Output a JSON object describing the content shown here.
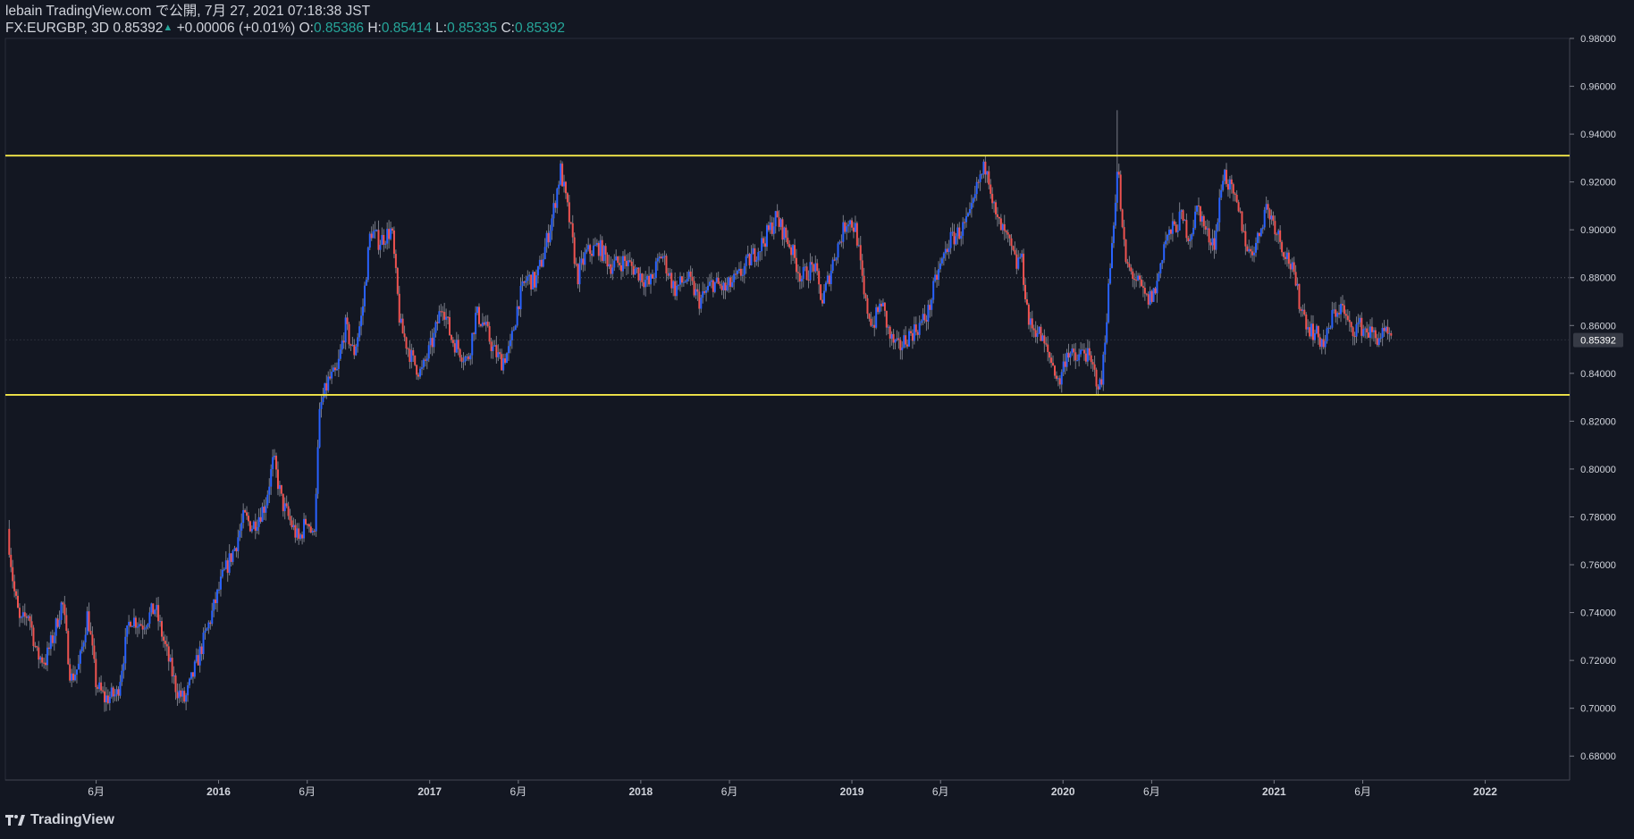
{
  "header": {
    "publisher_line": "lebain TradingView.com で公開, 7月 27, 2021 07:18:38 JST",
    "symbol": "FX:EURGBP, 3D",
    "last": "0.85392",
    "change": "+0.00006 (+0.01%)",
    "o_label": "O:",
    "o_value": "0.85386",
    "h_label": "H:",
    "h_value": "0.85414",
    "l_label": "L:",
    "l_value": "0.85335",
    "c_label": "C:",
    "c_value": "0.85392"
  },
  "footer": {
    "brand": "TradingView"
  },
  "colors": {
    "background": "#131722",
    "up": "#2962ff",
    "down": "#ef5350",
    "wick": "#787b86",
    "level_line": "#f5e94a",
    "axis_text": "#d1d4dc",
    "value_tag": "#363a45"
  },
  "chart_data": {
    "type": "candlestick",
    "symbol": "FX:EURGBP",
    "timeframe": "3D",
    "ylim": [
      0.67,
      0.98
    ],
    "y_ticks": [
      "0.68000",
      "0.70000",
      "0.72000",
      "0.74000",
      "0.76000",
      "0.78000",
      "0.80000",
      "0.82000",
      "0.84000",
      "0.86000",
      "0.88000",
      "0.90000",
      "0.92000",
      "0.94000",
      "0.96000",
      "0.98000"
    ],
    "x_ticks": [
      {
        "label": "6月",
        "t": 2015.42
      },
      {
        "label": "2016",
        "t": 2016.0
      },
      {
        "label": "6月",
        "t": 2016.42
      },
      {
        "label": "2017",
        "t": 2017.0
      },
      {
        "label": "6月",
        "t": 2017.42
      },
      {
        "label": "2018",
        "t": 2018.0
      },
      {
        "label": "6月",
        "t": 2018.42
      },
      {
        "label": "2019",
        "t": 2019.0
      },
      {
        "label": "6月",
        "t": 2019.42
      },
      {
        "label": "2020",
        "t": 2020.0
      },
      {
        "label": "6月",
        "t": 2020.42
      },
      {
        "label": "2021",
        "t": 2021.0
      },
      {
        "label": "6月",
        "t": 2021.42
      },
      {
        "label": "2022",
        "t": 2022.0
      }
    ],
    "xlim": [
      2014.99,
      2022.4
    ],
    "horizontal_levels": [
      0.931,
      0.831
    ],
    "current_price_tag": "0.85392",
    "close_path": [
      [
        "2015.00",
        0.775
      ],
      [
        "2015.03",
        0.75
      ],
      [
        "2015.06",
        0.735
      ],
      [
        "2015.10",
        0.74
      ],
      [
        "2015.14",
        0.722
      ],
      [
        "2015.18",
        0.72
      ],
      [
        "2015.22",
        0.731
      ],
      [
        "2015.26",
        0.745
      ],
      [
        "2015.30",
        0.712
      ],
      [
        "2015.34",
        0.718
      ],
      [
        "2015.38",
        0.74
      ],
      [
        "2015.42",
        0.71
      ],
      [
        "2015.46",
        0.704
      ],
      [
        "2015.52",
        0.706
      ],
      [
        "2015.58",
        0.738
      ],
      [
        "2015.64",
        0.735
      ],
      [
        "2015.70",
        0.742
      ],
      [
        "2015.74",
        0.728
      ],
      [
        "2015.80",
        0.708
      ],
      [
        "2015.84",
        0.703
      ],
      [
        "2015.90",
        0.72
      ],
      [
        "2015.96",
        0.737
      ],
      [
        "2016.02",
        0.755
      ],
      [
        "2016.08",
        0.768
      ],
      [
        "2016.12",
        0.78
      ],
      [
        "2016.16",
        0.776
      ],
      [
        "2016.22",
        0.785
      ],
      [
        "2016.26",
        0.804
      ],
      [
        "2016.30",
        0.786
      ],
      [
        "2016.34",
        0.778
      ],
      [
        "2016.38",
        0.77
      ],
      [
        "2016.42",
        0.78
      ],
      [
        "2016.45",
        0.77
      ],
      [
        "2016.48",
        0.825
      ],
      [
        "2016.52",
        0.837
      ],
      [
        "2016.56",
        0.84
      ],
      [
        "2016.60",
        0.86
      ],
      [
        "2016.64",
        0.848
      ],
      [
        "2016.68",
        0.865
      ],
      [
        "2016.72",
        0.9
      ],
      [
        "2016.76",
        0.895
      ],
      [
        "2016.82",
        0.9
      ],
      [
        "2016.86",
        0.86
      ],
      [
        "2016.92",
        0.845
      ],
      [
        "2016.96",
        0.84
      ],
      [
        "2017.02",
        0.855
      ],
      [
        "2017.06",
        0.87
      ],
      [
        "2017.10",
        0.855
      ],
      [
        "2017.14",
        0.85
      ],
      [
        "2017.18",
        0.845
      ],
      [
        "2017.22",
        0.865
      ],
      [
        "2017.26",
        0.86
      ],
      [
        "2017.30",
        0.85
      ],
      [
        "2017.34",
        0.845
      ],
      [
        "2017.38",
        0.85
      ],
      [
        "2017.42",
        0.87
      ],
      [
        "2017.46",
        0.88
      ],
      [
        "2017.50",
        0.878
      ],
      [
        "2017.54",
        0.89
      ],
      [
        "2017.58",
        0.905
      ],
      [
        "2017.62",
        0.925
      ],
      [
        "2017.66",
        0.905
      ],
      [
        "2017.70",
        0.88
      ],
      [
        "2017.74",
        0.89
      ],
      [
        "2017.80",
        0.893
      ],
      [
        "2017.86",
        0.885
      ],
      [
        "2017.92",
        0.887
      ],
      [
        "2017.98",
        0.883
      ],
      [
        "2018.04",
        0.877
      ],
      [
        "2018.10",
        0.89
      ],
      [
        "2018.16",
        0.875
      ],
      [
        "2018.22",
        0.88
      ],
      [
        "2018.28",
        0.87
      ],
      [
        "2018.34",
        0.878
      ],
      [
        "2018.40",
        0.875
      ],
      [
        "2018.46",
        0.88
      ],
      [
        "2018.52",
        0.888
      ],
      [
        "2018.58",
        0.895
      ],
      [
        "2018.64",
        0.905
      ],
      [
        "2018.70",
        0.895
      ],
      [
        "2018.76",
        0.88
      ],
      [
        "2018.82",
        0.885
      ],
      [
        "2018.86",
        0.87
      ],
      [
        "2018.92",
        0.89
      ],
      [
        "2018.98",
        0.905
      ],
      [
        "2019.02",
        0.9
      ],
      [
        "2019.06",
        0.87
      ],
      [
        "2019.10",
        0.86
      ],
      [
        "2019.14",
        0.87
      ],
      [
        "2019.18",
        0.855
      ],
      [
        "2019.22",
        0.85
      ],
      [
        "2019.26",
        0.855
      ],
      [
        "2019.32",
        0.86
      ],
      [
        "2019.36",
        0.865
      ],
      [
        "2019.40",
        0.88
      ],
      [
        "2019.46",
        0.895
      ],
      [
        "2019.52",
        0.9
      ],
      [
        "2019.56",
        0.905
      ],
      [
        "2019.60",
        0.92
      ],
      [
        "2019.64",
        0.928
      ],
      [
        "2019.68",
        0.905
      ],
      [
        "2019.74",
        0.895
      ],
      [
        "2019.78",
        0.885
      ],
      [
        "2019.80",
        0.89
      ],
      [
        "2019.84",
        0.86
      ],
      [
        "2019.88",
        0.858
      ],
      [
        "2019.92",
        0.85
      ],
      [
        "2019.96",
        0.842
      ],
      [
        "2019.98",
        0.835
      ],
      [
        "2020.02",
        0.85
      ],
      [
        "2020.06",
        0.845
      ],
      [
        "2020.10",
        0.85
      ],
      [
        "2020.14",
        0.842
      ],
      [
        "2020.18",
        0.833
      ],
      [
        "2020.22",
        0.88
      ],
      [
        "2020.26",
        0.928
      ],
      [
        "2020.28",
        0.9
      ],
      [
        "2020.30",
        0.885
      ],
      [
        "2020.34",
        0.88
      ],
      [
        "2020.40",
        0.87
      ],
      [
        "2020.44",
        0.875
      ],
      [
        "2020.48",
        0.895
      ],
      [
        "2020.52",
        0.9
      ],
      [
        "2020.56",
        0.905
      ],
      [
        "2020.60",
        0.897
      ],
      [
        "2020.64",
        0.91
      ],
      [
        "2020.68",
        0.898
      ],
      [
        "2020.72",
        0.895
      ],
      [
        "2020.76",
        0.925
      ],
      [
        "2020.80",
        0.915
      ],
      [
        "2020.84",
        0.905
      ],
      [
        "2020.88",
        0.89
      ],
      [
        "2020.92",
        0.895
      ],
      [
        "2020.96",
        0.91
      ],
      [
        "2021.00",
        0.903
      ],
      [
        "2021.04",
        0.893
      ],
      [
        "2021.08",
        0.885
      ],
      [
        "2021.12",
        0.87
      ],
      [
        "2021.16",
        0.86
      ],
      [
        "2021.20",
        0.856
      ],
      [
        "2021.24",
        0.852
      ],
      [
        "2021.28",
        0.865
      ],
      [
        "2021.32",
        0.868
      ],
      [
        "2021.36",
        0.858
      ],
      [
        "2021.40",
        0.86
      ],
      [
        "2021.44",
        0.858
      ],
      [
        "2021.48",
        0.855
      ],
      [
        "2021.52",
        0.856
      ],
      [
        "2021.56",
        0.854
      ]
    ],
    "notable_highs": [
      {
        "t": "2020.26",
        "high": 0.95
      }
    ]
  }
}
